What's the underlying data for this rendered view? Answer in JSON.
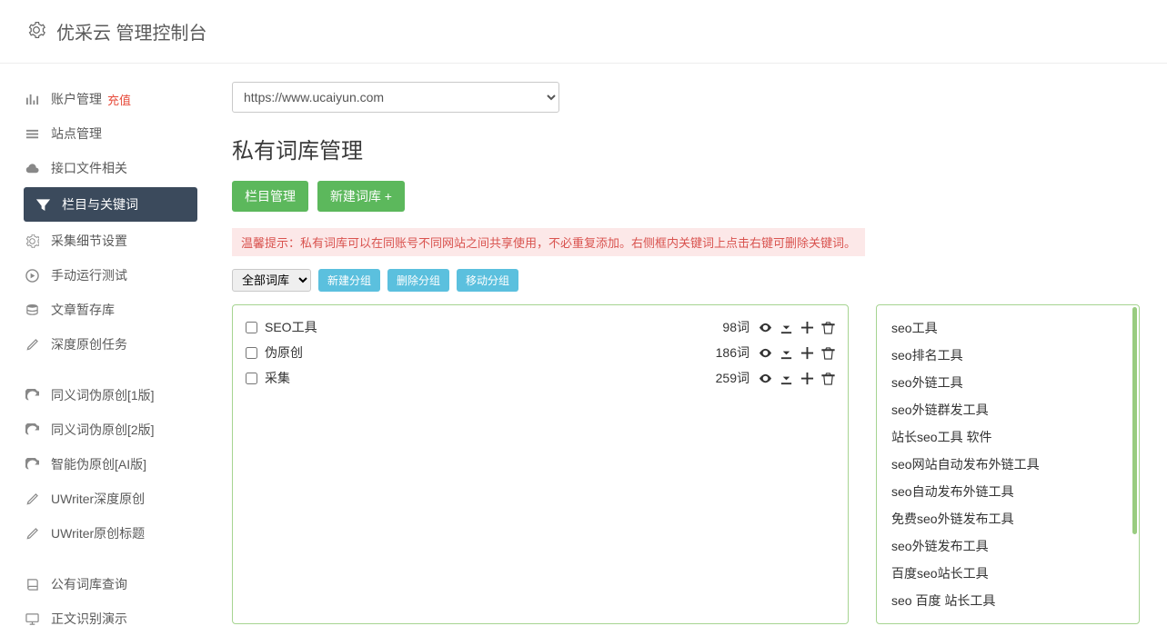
{
  "header": {
    "brand": "优采云 管理控制台"
  },
  "sidebar": {
    "items": [
      {
        "label": "账户管理",
        "icon": "bar-chart",
        "badge": "充值"
      },
      {
        "label": "站点管理",
        "icon": "list"
      },
      {
        "label": "接口文件相关",
        "icon": "cloud"
      },
      {
        "label": "栏目与关键词",
        "icon": "filter",
        "active": true
      },
      {
        "label": "采集细节设置",
        "icon": "gears"
      },
      {
        "label": "手动运行测试",
        "icon": "play"
      },
      {
        "label": "文章暂存库",
        "icon": "database"
      },
      {
        "label": "深度原创任务",
        "icon": "edit"
      }
    ],
    "tools": [
      {
        "label": "同义词伪原创[1版]",
        "icon": "refresh"
      },
      {
        "label": "同义词伪原创[2版]",
        "icon": "refresh"
      },
      {
        "label": "智能伪原创[AI版]",
        "icon": "refresh"
      },
      {
        "label": "UWriter深度原创",
        "icon": "edit"
      },
      {
        "label": "UWriter原创标题",
        "icon": "edit"
      }
    ],
    "extra": [
      {
        "label": "公有词库查询",
        "icon": "book"
      },
      {
        "label": "正文识别演示",
        "icon": "monitor"
      }
    ]
  },
  "main": {
    "site_selector": {
      "selected": "https://www.ucaiyun.com"
    },
    "page_title": "私有词库管理",
    "buttons": {
      "column_manage": "栏目管理",
      "new_wordlib": "新建词库 +"
    },
    "hint": "温馨提示：私有词库可以在同账号不同网站之间共享使用，不必重复添加。右侧框内关键词上点击右键可删除关键词。",
    "group_filter": {
      "selected": "全部词库",
      "btn_new": "新建分组",
      "btn_delete": "删除分组",
      "btn_move": "移动分组"
    },
    "wordlibs": [
      {
        "name": "SEO工具",
        "count": "98词"
      },
      {
        "name": "伪原创",
        "count": "186词"
      },
      {
        "name": "采集",
        "count": "259词"
      }
    ],
    "keywords": [
      "seo工具",
      "seo排名工具",
      "seo外链工具",
      "seo外链群发工具",
      "站长seo工具 软件",
      "seo网站自动发布外链工具",
      "seo自动发布外链工具",
      "免费seo外链发布工具",
      "seo外链发布工具",
      "百度seo站长工具",
      "seo 百度 站长工具"
    ]
  }
}
